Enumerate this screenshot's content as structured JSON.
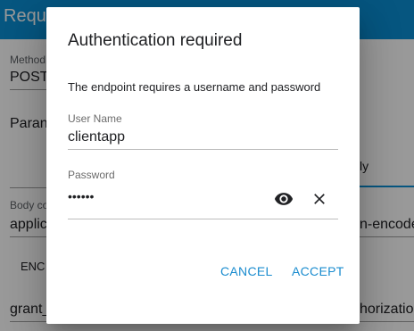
{
  "background": {
    "app_title": "Reque",
    "method_label": "Method",
    "method_value": "POST",
    "params_label": "Paran",
    "tab_partial": "ly",
    "body_label": "Body co",
    "body_content_type": "applic",
    "body_content_type_right": "n-encode",
    "encode_label": "ENC",
    "grant_text": "grant_",
    "authorization_text": "horization"
  },
  "dialog": {
    "title": "Authentication required",
    "description": "The endpoint requires a username and password",
    "username": {
      "label": "User Name",
      "value": "clientapp"
    },
    "password": {
      "label": "Password",
      "value": "••••••",
      "toggle_icon": "eye-icon",
      "clear_icon": "close-icon"
    },
    "cancel_label": "CANCEL",
    "accept_label": "ACCEPT",
    "accent_color": "#1a8ccf"
  }
}
